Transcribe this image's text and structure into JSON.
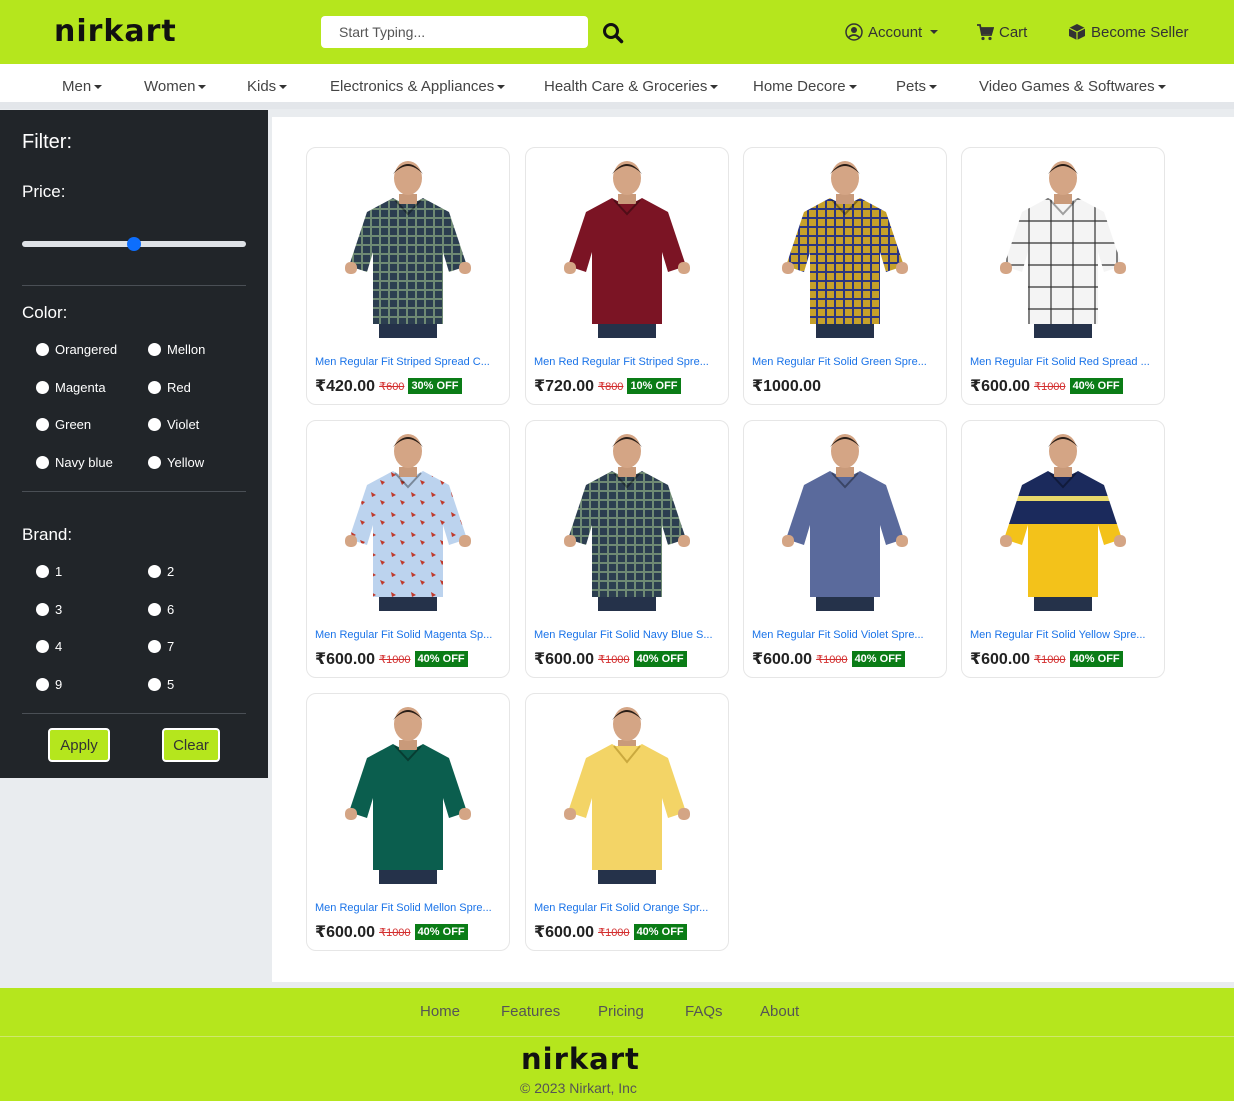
{
  "header": {
    "logo": "nirkart",
    "search_placeholder": "Start Typing...",
    "account_label": "Account",
    "cart_label": "Cart",
    "seller_label": "Become Seller",
    "accent_color": "#b5e61d"
  },
  "categories": [
    "Men",
    "Women",
    "Kids",
    "Electronics & Appliances",
    "Health Care & Groceries",
    "Home Decore",
    "Pets",
    "Video Games & Softwares"
  ],
  "filter": {
    "title": "Filter:",
    "price_label": "Price:",
    "price_slider_fraction": 0.5,
    "color_label": "Color:",
    "colors": [
      "Orangered",
      "Mellon",
      "Magenta",
      "Red",
      "Green",
      "Violet",
      "Navy blue",
      "Yellow"
    ],
    "brand_label": "Brand:",
    "brands": [
      "1",
      "2",
      "3",
      "6",
      "4",
      "7",
      "9",
      "5"
    ],
    "apply_label": "Apply",
    "clear_label": "Clear"
  },
  "products": [
    {
      "name": "Men Regular Fit Striped Spread C...",
      "price": "₹420.00",
      "mrp": "₹600",
      "off": "30% OFF",
      "shirt": "#2c3e50",
      "pattern": "check"
    },
    {
      "name": "Men Red Regular Fit Striped Spre...",
      "price": "₹720.00",
      "mrp": "₹800",
      "off": "10% OFF",
      "shirt": "#7b1424",
      "pattern": "plain"
    },
    {
      "name": "Men Regular Fit Solid Green Spre...",
      "price": "₹1000.00",
      "mrp": "",
      "off": "",
      "shirt": "#c6a02a",
      "pattern": "check-dark"
    },
    {
      "name": "Men Regular Fit Solid Red Spread ...",
      "price": "₹600.00",
      "mrp": "₹1000",
      "off": "40% OFF",
      "shirt": "#f4f4f4",
      "pattern": "check-thin"
    },
    {
      "name": "Men Regular Fit Solid Magenta Sp...",
      "price": "₹600.00",
      "mrp": "₹1000",
      "off": "40% OFF",
      "shirt": "#bcd3ee",
      "pattern": "print"
    },
    {
      "name": "Men Regular Fit Solid Navy Blue S...",
      "price": "₹600.00",
      "mrp": "₹1000",
      "off": "40% OFF",
      "shirt": "#2c3e50",
      "pattern": "check"
    },
    {
      "name": "Men Regular Fit Solid Violet Spre...",
      "price": "₹600.00",
      "mrp": "₹1000",
      "off": "40% OFF",
      "shirt": "#5a6a9c",
      "pattern": "plain"
    },
    {
      "name": "Men Regular Fit Solid Yellow Spre...",
      "price": "₹600.00",
      "mrp": "₹1000",
      "off": "40% OFF",
      "shirt": "#1b2a5c",
      "pattern": "stripe-yellow"
    },
    {
      "name": "Men Regular Fit Solid Mellon Spre...",
      "price": "₹600.00",
      "mrp": "₹1000",
      "off": "40% OFF",
      "shirt": "#0b5e4e",
      "pattern": "plain"
    },
    {
      "name": "Men Regular Fit Solid Orange Spr...",
      "price": "₹600.00",
      "mrp": "₹1000",
      "off": "40% OFF",
      "shirt": "#f3d466",
      "pattern": "polo"
    }
  ],
  "footer": {
    "links": [
      "Home",
      "Features",
      "Pricing",
      "FAQs",
      "About"
    ],
    "logo": "nirkart",
    "copyright": "© 2023 Nirkart, Inc"
  }
}
